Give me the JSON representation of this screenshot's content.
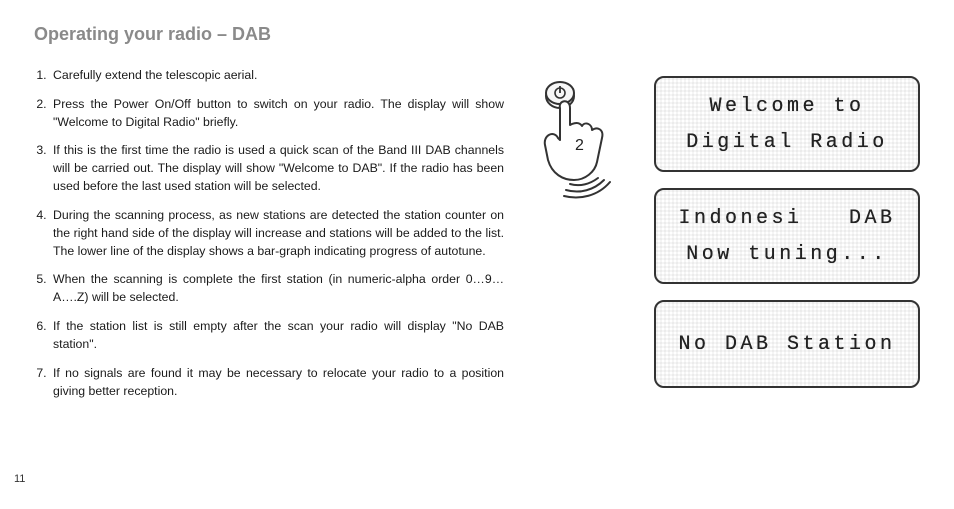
{
  "heading": "Operating your radio – DAB",
  "steps": [
    "Carefully extend the telescopic aerial.",
    "Press the Power On/Off button to switch on your radio. The display will show \"Welcome to Digital Radio\" briefly.",
    "If this is the first time the radio is used a quick scan of the Band III DAB channels will be carried out. The display will show \"Welcome to DAB\". If the radio has been used before the last used station will be selected.",
    "During the scanning process, as new stations are detected the station counter on the right hand side of the display will increase and stations will be added to the list. The lower line of the display shows a bar-graph indicating progress of autotune.",
    "When the scanning is complete the first station (in numeric-alpha order 0…9…A….Z) will be selected.",
    "If the station list is still empty after the scan your radio will display \"No DAB station\".",
    "If no signals are found it may be necessary to relocate your radio to a position giving better reception."
  ],
  "page_number": "11",
  "hand": {
    "step_number": "2",
    "button_icon": "power-icon"
  },
  "screens": {
    "s1": {
      "line1": "Welcome to",
      "line2": "Digital Radio"
    },
    "s2": {
      "line1": "Indonesi   DAB",
      "line2": "Now tuning..."
    },
    "s3": {
      "line1": "No DAB Station"
    }
  }
}
